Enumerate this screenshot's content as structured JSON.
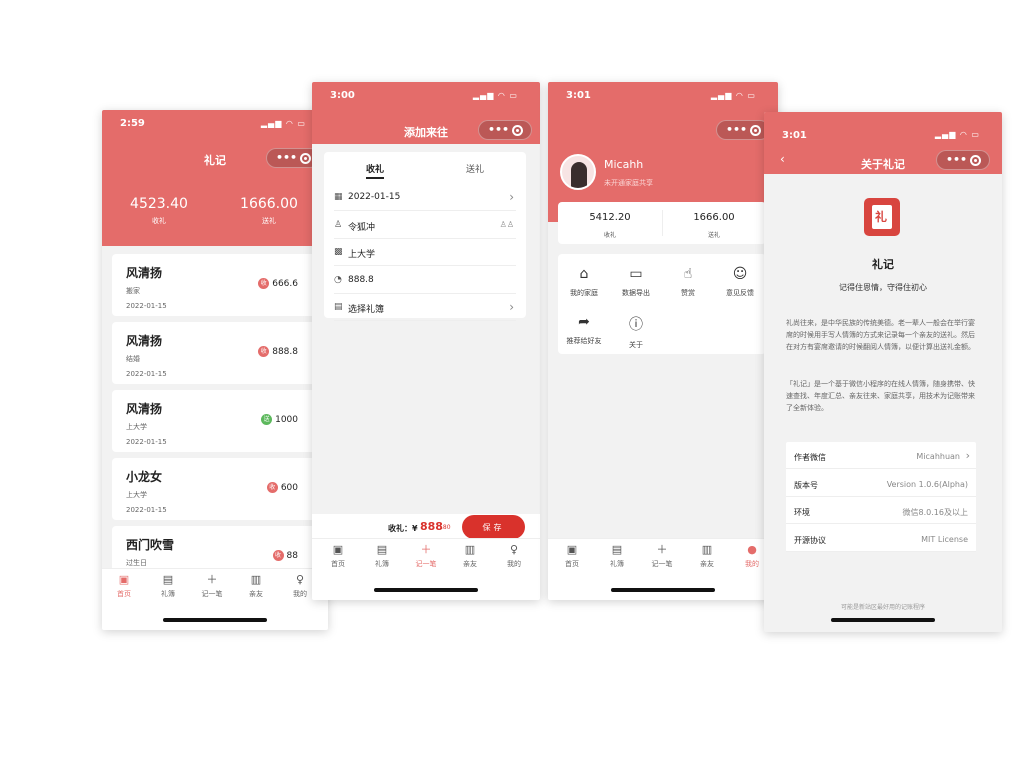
{
  "colors": {
    "brand": "#e46c6a",
    "received_badge": "#e46c6a",
    "sent_badge": "#5cb85c"
  },
  "tabbar": [
    {
      "label": "首页",
      "icon": "home-icon"
    },
    {
      "label": "礼簿",
      "icon": "book-icon"
    },
    {
      "label": "记一笔",
      "icon": "plus-icon"
    },
    {
      "label": "亲友",
      "icon": "contacts-icon"
    },
    {
      "label": "我的",
      "icon": "user-icon"
    }
  ],
  "screen1": {
    "time": "2:59",
    "title": "礼记",
    "received_total": "4523.40",
    "received_label": "收礼",
    "sent_total": "1666.00",
    "sent_label": "送礼",
    "items": [
      {
        "name": "风清扬",
        "event": "搬家",
        "date": "2022-01-15",
        "badge": "收",
        "amount": "666.6",
        "type": "received"
      },
      {
        "name": "风清扬",
        "event": "结婚",
        "date": "2022-01-15",
        "badge": "收",
        "amount": "888.8",
        "type": "received"
      },
      {
        "name": "风清扬",
        "event": "上大学",
        "date": "2022-01-15",
        "badge": "送",
        "amount": "1000",
        "type": "sent"
      },
      {
        "name": "小龙女",
        "event": "上大学",
        "date": "2022-01-15",
        "badge": "收",
        "amount": "600",
        "type": "received"
      },
      {
        "name": "西门吹雪",
        "event": "过生日",
        "date": "",
        "badge": "收",
        "amount": "88",
        "type": "received"
      }
    ]
  },
  "screen2": {
    "time": "3:00",
    "title": "添加来往",
    "tab_received": "收礼",
    "tab_sent": "送礼",
    "fields": [
      {
        "icon": "calendar-icon",
        "text": "2022-01-15",
        "chevron": true
      },
      {
        "icon": "person-icon",
        "text": "令狐冲",
        "chevron": false
      },
      {
        "icon": "gift-icon",
        "text": "上大学",
        "chevron": false
      },
      {
        "icon": "money-bag-icon",
        "text": "888.8",
        "chevron": false
      },
      {
        "icon": "ledger-icon",
        "text": "选择礼簿",
        "chevron": true
      }
    ],
    "footer_label": "收礼：¥",
    "footer_amount_int": "888",
    "footer_amount_dec": ".80",
    "save_label": "保存"
  },
  "screen3": {
    "time": "3:01",
    "username": "Micahh",
    "subtitle": "未开通家庭共享",
    "received_total": "5412.20",
    "received_label": "收礼",
    "sent_total": "1666.00",
    "sent_label": "送礼",
    "grid": [
      {
        "label": "我的家庭",
        "icon": "shop-icon"
      },
      {
        "label": "数据导出",
        "icon": "wallet-icon"
      },
      {
        "label": "赞赏",
        "icon": "thumbs-up-icon"
      },
      {
        "label": "意见反馈",
        "icon": "feedback-icon"
      },
      {
        "label": "推荐给好友",
        "icon": "share-icon"
      },
      {
        "label": "关于",
        "icon": "info-icon"
      }
    ]
  },
  "screen4": {
    "time": "3:01",
    "title": "关于礼记",
    "logo_char": "礼",
    "app_name": "礼记",
    "slogan": "记得住恩情，守得住初心",
    "para1": "礼尚往来，是中华民族的传统美德。老一辈人一般会在举行宴席的时候用手写人情簿的方式来记录每一个亲友的送礼。然后在对方有宴席邀请的时候翻阅人情簿，以便计算出送礼金额。",
    "para2": "「礼记」是一个基于微信小程序的在线人情簿，随身携带、快速查找、年度汇总、亲友往来、家庭共享，用技术为记账带来了全新体验。",
    "info": [
      {
        "k": "作者微信",
        "v": "Micahhuan",
        "chevron": true
      },
      {
        "k": "版本号",
        "v": "Version 1.0.6(Alpha)",
        "chevron": false
      },
      {
        "k": "环境",
        "v": "微信8.0.16及以上",
        "chevron": false
      },
      {
        "k": "开源协议",
        "v": "MIT License",
        "chevron": false
      }
    ],
    "footer": "可能是新站区最好用的记账程序"
  }
}
